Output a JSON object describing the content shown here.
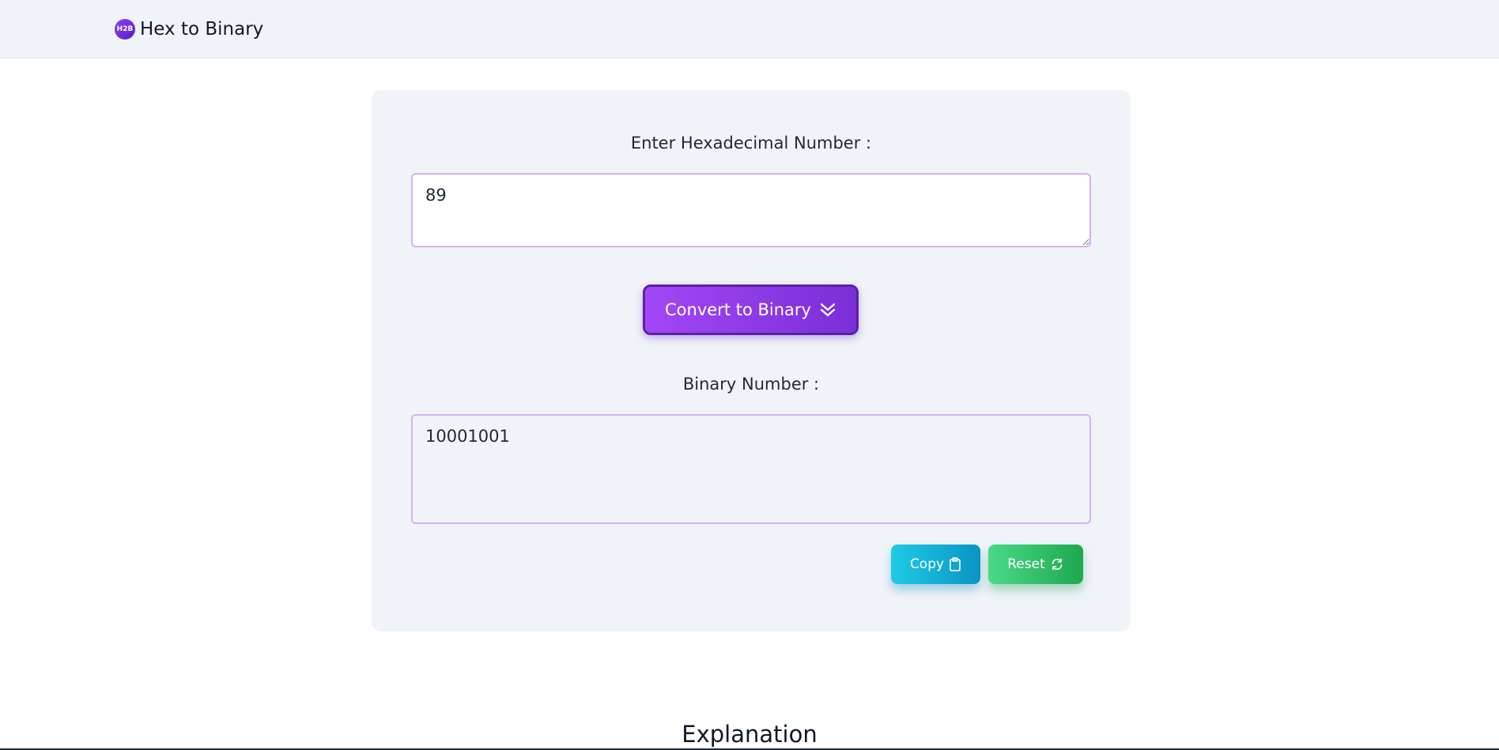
{
  "header": {
    "logo_text": "H2B",
    "title": "Hex to Binary"
  },
  "converter": {
    "input_label": "Enter Hexadecimal Number :",
    "input_value": "89",
    "convert_label": "Convert to Binary",
    "output_label": "Binary Number :",
    "output_value": "10001001",
    "copy_label": "Copy",
    "reset_label": "Reset"
  },
  "explanation": {
    "title": "Explanation"
  },
  "icons": {
    "convert": "double-chevron-down-icon",
    "copy": "clipboard-icon",
    "reset": "refresh-icon"
  },
  "colors": {
    "accent_purple": "#8b3dff",
    "copy_cyan": "#0a94c4",
    "reset_green": "#1ea84f",
    "card_bg": "#f0f3f8"
  }
}
